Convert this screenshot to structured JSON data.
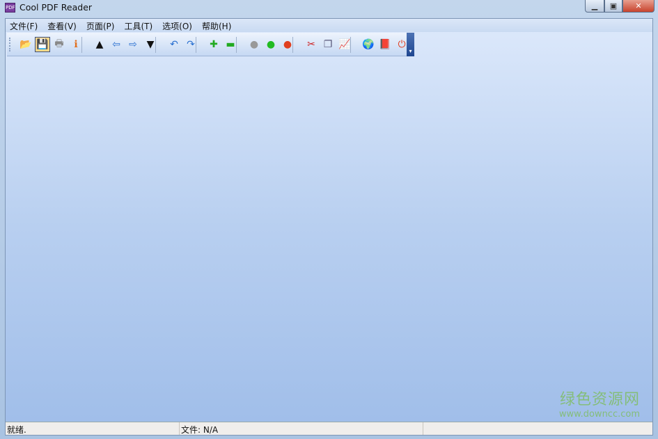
{
  "window": {
    "title": "Cool PDF Reader",
    "app_icon_text": "PDF"
  },
  "menu": [
    "文件(F)",
    "查看(V)",
    "页面(P)",
    "工具(T)",
    "选项(O)",
    "帮助(H)"
  ],
  "toolbar": {
    "buttons": [
      {
        "name": "open-icon",
        "glyph": "📂",
        "color": "#e8a020"
      },
      {
        "name": "save-icon",
        "glyph": "💾",
        "color": "#5a4aa0",
        "active": true
      },
      {
        "name": "print-icon",
        "glyph": "🖶",
        "color": "#888"
      },
      {
        "name": "info-icon",
        "glyph": "ℹ",
        "color": "#e07020"
      },
      {
        "name": "first-page-icon",
        "glyph": "▲",
        "color": "#111"
      },
      {
        "name": "previous-page-icon",
        "glyph": "⇦",
        "color": "#2a70d0"
      },
      {
        "name": "next-page-icon",
        "glyph": "⇨",
        "color": "#2a70d0"
      },
      {
        "name": "last-page-icon",
        "glyph": "▼",
        "color": "#111"
      },
      {
        "name": "undo-icon",
        "glyph": "↶",
        "color": "#2a70d0"
      },
      {
        "name": "redo-icon",
        "glyph": "↷",
        "color": "#2a70d0"
      },
      {
        "name": "zoom-in-icon",
        "glyph": "✚",
        "color": "#22aa22"
      },
      {
        "name": "zoom-out-icon",
        "glyph": "▬",
        "color": "#22aa22"
      },
      {
        "name": "gray-light-icon",
        "glyph": "●",
        "color": "#999999"
      },
      {
        "name": "green-light-icon",
        "glyph": "●",
        "color": "#22bb22"
      },
      {
        "name": "red-light-icon",
        "glyph": "●",
        "color": "#e04020"
      },
      {
        "name": "scissors-icon",
        "glyph": "✂",
        "color": "#cc2222"
      },
      {
        "name": "copy-icon",
        "glyph": "❐",
        "color": "#557"
      },
      {
        "name": "chart-icon",
        "glyph": "📈",
        "color": "#c84"
      },
      {
        "name": "globe-icon",
        "glyph": "🌍",
        "color": "#2a70d0"
      },
      {
        "name": "help-book-icon",
        "glyph": "📕",
        "color": "#8a2080"
      },
      {
        "name": "power-icon",
        "glyph": "⏻",
        "color": "#e04020"
      }
    ]
  },
  "status": {
    "ready": "就绪.",
    "file": "文件: N/A"
  },
  "watermark": {
    "cn": "绿色资源网",
    "url": "www.downcc.com"
  }
}
